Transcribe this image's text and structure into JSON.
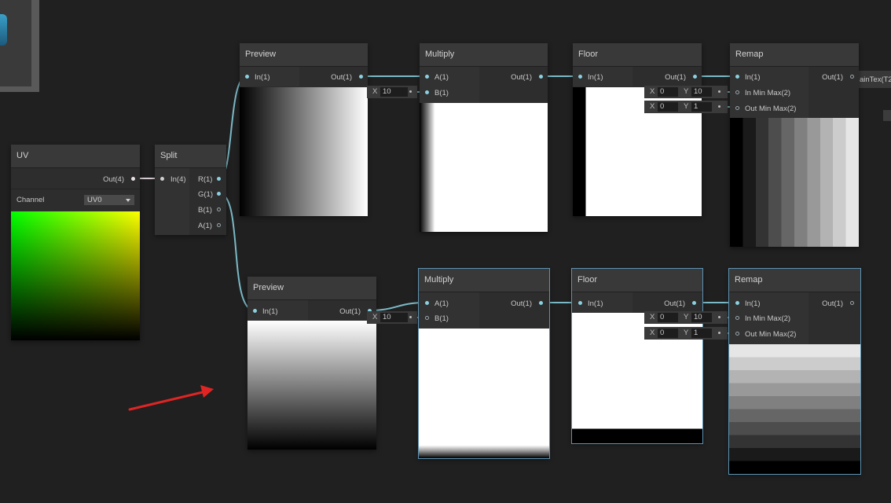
{
  "nodes": {
    "uv": {
      "title": "UV",
      "out": "Out(4)",
      "channel_label": "Channel",
      "channel_value": "UV0"
    },
    "split": {
      "title": "Split",
      "in": "In(4)",
      "outs": [
        "R(1)",
        "G(1)",
        "B(1)",
        "A(1)"
      ]
    },
    "preview_top": {
      "title": "Preview",
      "in": "In(1)",
      "out": "Out(1)"
    },
    "preview_bottom": {
      "title": "Preview",
      "in": "In(1)",
      "out": "Out(1)"
    },
    "multiply_top": {
      "title": "Multiply",
      "in_a": "A(1)",
      "in_b": "B(1)",
      "out": "Out(1)",
      "x_label": "X",
      "x_value": "10"
    },
    "multiply_bottom": {
      "title": "Multiply",
      "in_a": "A(1)",
      "in_b": "B(1)",
      "out": "Out(1)",
      "x_label": "X",
      "x_value": "10"
    },
    "floor_top": {
      "title": "Floor",
      "in": "In(1)",
      "out": "Out(1)"
    },
    "floor_bottom": {
      "title": "Floor",
      "in": "In(1)",
      "out": "Out(1)"
    },
    "remap_top": {
      "title": "Remap",
      "in": "In(1)",
      "in_minmax": "In Min Max(2)",
      "out_minmax": "Out Min Max(2)",
      "out": "Out(1)",
      "f1": {
        "x": "X",
        "x_val": "0",
        "y": "Y",
        "y_val": "10"
      },
      "f2": {
        "x": "X",
        "x_val": "0",
        "y": "Y",
        "y_val": "1"
      }
    },
    "remap_bottom": {
      "title": "Remap",
      "in": "In(1)",
      "in_minmax": "In Min Max(2)",
      "out_minmax": "Out Min Max(2)",
      "out": "Out(1)",
      "f1": {
        "x": "X",
        "x_val": "0",
        "y": "Y",
        "y_val": "10"
      },
      "f2": {
        "x": "X",
        "x_val": "0",
        "y": "Y",
        "y_val": "1"
      }
    }
  },
  "offscreen_label": "ainTex(T2",
  "colors": {
    "wire": "#7ab9c6",
    "wire_uv": "#d6cbd3",
    "arrow": "#e02424",
    "selection": "#5d93b2"
  }
}
